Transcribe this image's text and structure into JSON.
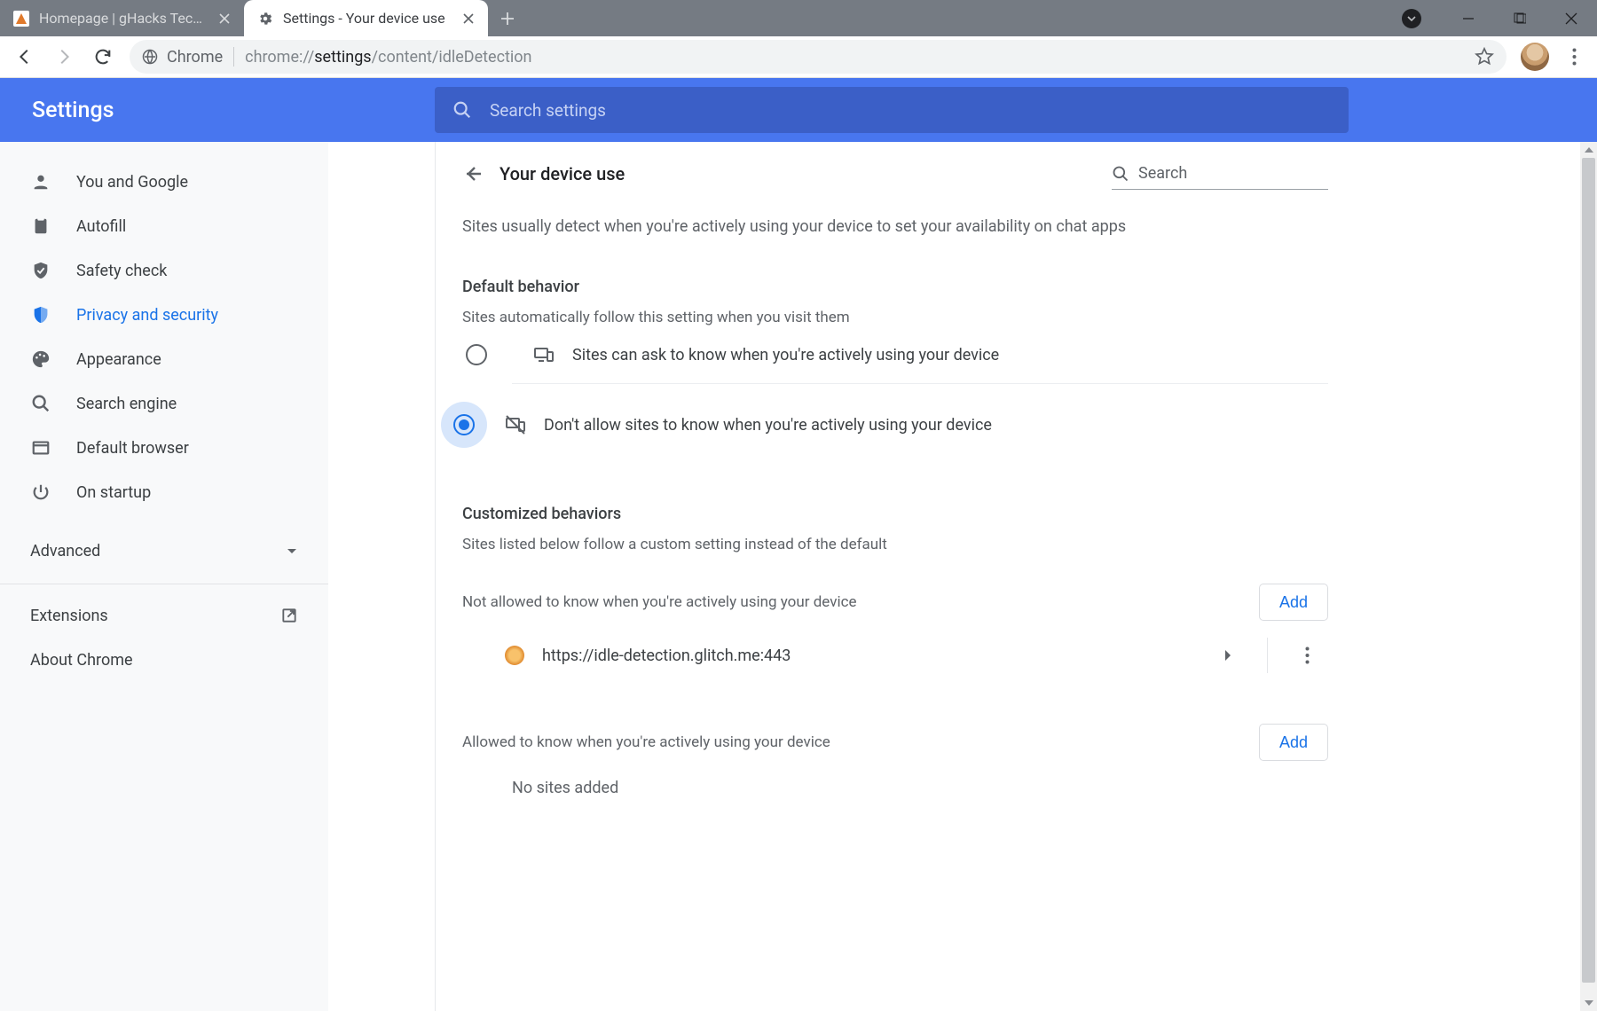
{
  "chrome": {
    "tabs": [
      {
        "title": "Homepage | gHacks Technology"
      },
      {
        "title": "Settings - Your device use"
      }
    ],
    "omnibox": {
      "secure_label": "Chrome",
      "url_dim_pre": "chrome://",
      "url_bold": "settings",
      "url_dim_post": "/content/idleDetection"
    }
  },
  "settings": {
    "brand": "Settings",
    "search_placeholder": "Search settings",
    "sidebar": {
      "items": [
        "You and Google",
        "Autofill",
        "Safety check",
        "Privacy and security",
        "Appearance",
        "Search engine",
        "Default browser",
        "On startup"
      ],
      "advanced": "Advanced",
      "extensions": "Extensions",
      "about": "About Chrome"
    },
    "panel": {
      "title": "Your device use",
      "search_label": "Search",
      "description": "Sites usually detect when you're actively using your device to set your availability on chat apps",
      "default_behavior": {
        "title": "Default behavior",
        "subtitle": "Sites automatically follow this setting when you visit them",
        "options": [
          "Sites can ask to know when you're actively using your device",
          "Don't allow sites to know when you're actively using your device"
        ],
        "selected_index": 1
      },
      "custom": {
        "title": "Customized behaviors",
        "subtitle": "Sites listed below follow a custom setting instead of the default",
        "block": {
          "heading": "Not allowed to know when you're actively using your device",
          "add": "Add",
          "sites": [
            "https://idle-detection.glitch.me:443"
          ]
        },
        "allow": {
          "heading": "Allowed to know when you're actively using your device",
          "add": "Add",
          "empty": "No sites added"
        }
      }
    }
  }
}
